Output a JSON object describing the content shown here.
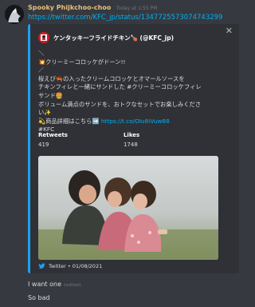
{
  "message": {
    "username": "Spooky Phijkchoo-choo",
    "timestamp": "Today at 1:55 PM",
    "link": "https://twitter.com/KFC_jp/status/1347725573074743299"
  },
  "embed": {
    "author": "ケンタッキーフライドチキン🍗 (@KFC_jp)",
    "description_lines": [
      "＼",
      "💥クリーミーコロッケがドーン!!",
      "／",
      "桜えび🦐の入ったクリームコロッケとオマールソースを",
      "チキンフィレと一緒にサンドした #クリーミーコロッケフィレ",
      "サンド🍔",
      "ボリューム満点のサンドを、おトクなセットでお楽しみくださ",
      "い✨",
      "💫商品詳細はこちら➡️ "
    ],
    "short_link": "https://t.co/OIu8iVuw88",
    "hashtag": "#KFC",
    "fields": [
      {
        "name": "Retweets",
        "value": "419"
      },
      {
        "name": "Likes",
        "value": "1748"
      }
    ],
    "footer": "Twitter • 01/08/2021"
  },
  "followups": [
    {
      "text": "I want one",
      "edited": "(edited)"
    },
    {
      "text": "So bad"
    }
  ],
  "colors": {
    "background": "#36393f",
    "embed_bg": "#2f3136",
    "embed_border": "#1da1f2",
    "link": "#00b0f4"
  },
  "icons": [
    "avatar-icon",
    "kfc-logo-icon",
    "close-icon",
    "twitter-icon"
  ]
}
